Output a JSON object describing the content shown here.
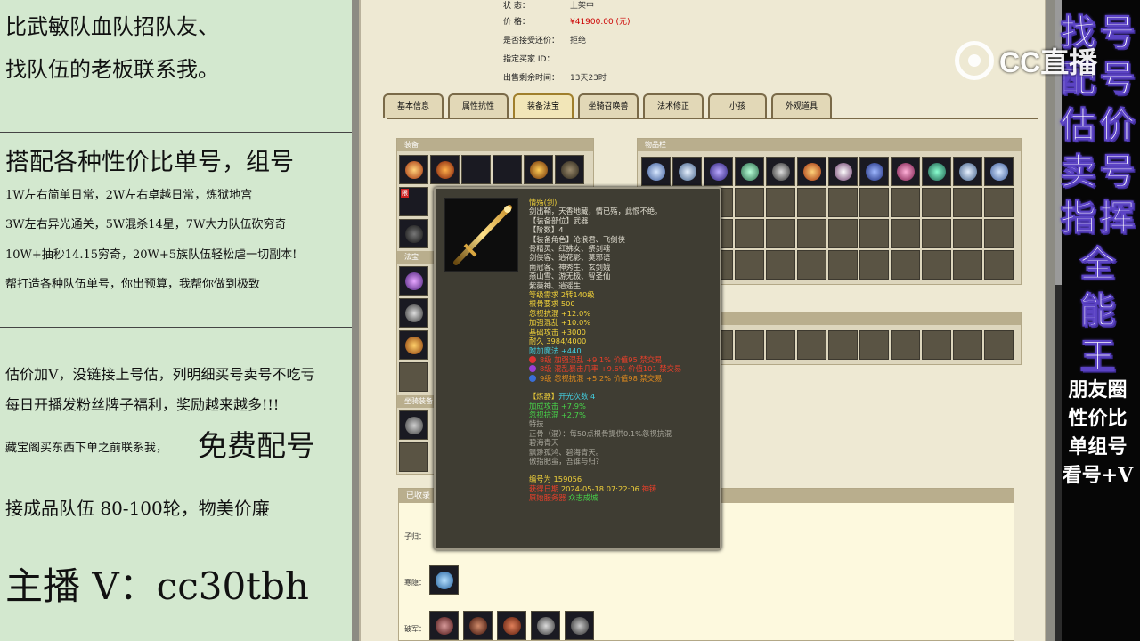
{
  "left_panel": {
    "line1": "比武敏队血队招队友、",
    "line2": "找队伍的老板联系我。",
    "line3": "搭配各种性价比单号，组号",
    "line4": "1W左右简单日常，2W左右卓越日常，炼狱地宫",
    "line5": "3W左右异光通关，5W混杀14星，7W大力队伍砍穷奇",
    "line6": "10W+抽秒14.15穷奇，20W+5族队伍轻松虐一切副本!",
    "line7": "帮打造各种队伍单号，你出预算，我帮你做到极致",
    "line8": "估价加V，没链接上号估，列明细买号卖号不吃亏",
    "line9": "每日开播发粉丝牌子福利，奖励越来越多!!!",
    "line10_a": "藏宝阁买东西下单之前联系我，",
    "line10_b": "免费配号",
    "line11": "接成品队伍 80-100轮，物美价廉",
    "line12": "主播 V：cc30tbh"
  },
  "info": {
    "status_label": "状 态：",
    "status_value": "上架中",
    "price_label": "价 格：",
    "price_value": "¥41900.00 (元)",
    "bargain_label": "是否接受还价：",
    "bargain_value": "拒绝",
    "buyer_label": "指定买家 ID：",
    "buyer_value": "",
    "time_label": "出售剩余时间：",
    "time_value": "13天23时"
  },
  "tabs": [
    "基本信息",
    "属性抗性",
    "装备法宝",
    "坐骑召唤兽",
    "法术修正",
    "小孩",
    "外观道具"
  ],
  "active_tab": "装备法宝",
  "panels": {
    "equip": "装备",
    "fabao": "法宝",
    "inventory": "物品栏",
    "mount": "坐骑装备",
    "collected": "已收录"
  },
  "equip_slot_badge": "限",
  "collected_rows": [
    "子归：",
    "寒隐：",
    "破军："
  ],
  "tooltip": {
    "name": "情殇(剑)",
    "desc": "剑出鞘，天香地藏，情已殇，此恨不绝。",
    "slot": "【装备部位】武器",
    "tier": "【阶数】4",
    "role_label": "【装备角色】沧浪君、飞剑侠",
    "roles2": "骨精灵、红拂女、祭剑魂",
    "roles3": "剑侠客、逍花影、莫邪语",
    "roles4": "南冠客、神秀生、玄剑娥",
    "roles5": "燕山雪、游无极、智圣仙",
    "roles6": "紫薇神、逍遥生",
    "level_req": "等级需求 2转140级",
    "gengu_req": "根骨要求 500",
    "ignore_chaos": "忽视抗混 +12.0%",
    "boost_chaos": "加强混乱 +10.0%",
    "base_atk": "基础攻击 +3000",
    "durability": "耐久 3984/4000",
    "extra_magic": "附加魔法 +440",
    "gem1": "8级 加强混乱 +9.1% 价值95 禁交易",
    "gem2": "8级 混乱暴击几率 +9.6% 价值101 禁交易",
    "gem3": "9级 忽视抗混 +5.2% 价值98 禁交易",
    "refine_label": "【炼器】",
    "refine_value": "开光次数 4",
    "refine1": "加成攻击 +7.9%",
    "refine2": "忽视抗混 +2.7%",
    "special_label": "特技",
    "special1": "正骨（混）：每50点根骨提供0.1%忽视抗混",
    "special2": "碧海青天",
    "special3": "飘渺孤鸿、碧海青天。",
    "special4": "傲指肥蛮，吾谁与归?",
    "serial": "编号为 159056",
    "date_label": "获得日期",
    "date_value": "2024-05-18 07:22:06",
    "date_tail": "神铸",
    "server_label": "原始服务器",
    "server_value": "众志成城",
    "colors": {
      "yellow": "#f2d23a",
      "green": "#47d44a",
      "cyan": "#43cfe0",
      "red": "#ea3f2a"
    }
  },
  "right_banner": {
    "chars": [
      "找",
      "号",
      "配",
      "号",
      "估",
      "价",
      "卖",
      "号",
      "指",
      "挥",
      "全",
      "能",
      "王"
    ],
    "line_a": "朋友圈",
    "line_b": "性价比",
    "line_c": "单组号",
    "line_d": "看号+V"
  },
  "watermark": {
    "text": "CC直播",
    "logo": "cc-logo-icon"
  }
}
